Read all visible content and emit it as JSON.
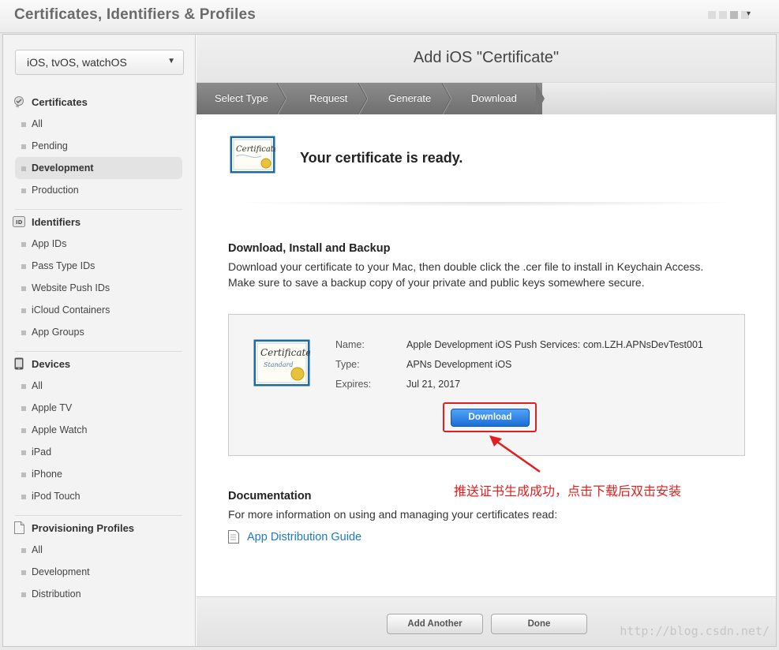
{
  "app": {
    "title": "Certificates, Identifiers & Profiles"
  },
  "sidebar": {
    "platform": "iOS, tvOS, watchOS",
    "sections": [
      {
        "title": "Certificates",
        "icon": "certificate-icon",
        "items": [
          "All",
          "Pending",
          "Development",
          "Production"
        ],
        "active": "Development"
      },
      {
        "title": "Identifiers",
        "icon": "id-badge-icon",
        "items": [
          "App IDs",
          "Pass Type IDs",
          "Website Push IDs",
          "iCloud Containers",
          "App Groups"
        ]
      },
      {
        "title": "Devices",
        "icon": "phone-icon",
        "items": [
          "All",
          "Apple TV",
          "Apple Watch",
          "iPad",
          "iPhone",
          "iPod Touch"
        ]
      },
      {
        "title": "Provisioning Profiles",
        "icon": "document-icon",
        "items": [
          "All",
          "Development",
          "Distribution"
        ]
      }
    ]
  },
  "main": {
    "page_title": "Add iOS \"Certificate\"",
    "steps": [
      "Select Type",
      "Request",
      "Generate",
      "Download"
    ],
    "ready_text": "Your certificate is ready.",
    "download_section": {
      "heading": "Download, Install and Backup",
      "text": "Download your certificate to your Mac, then double click the .cer file to install in Keychain Access. Make sure to save a backup copy of your private and public keys somewhere secure."
    },
    "certificate": {
      "name_label": "Name:",
      "name_value": "Apple Development iOS Push Services: com.LZH.APNsDevTest001",
      "type_label": "Type:",
      "type_value": "APNs Development iOS",
      "expires_label": "Expires:",
      "expires_value": "Jul 21, 2017",
      "download_label": "Download",
      "badge_title": "Certificate",
      "badge_sub": "Standard"
    },
    "annotation": "推送证书生成成功，点击下载后双击安装",
    "documentation": {
      "heading": "Documentation",
      "text": "For more information on using and managing your certificates read:",
      "link": "App Distribution Guide"
    },
    "footer": {
      "add_another": "Add Another",
      "done": "Done"
    }
  },
  "watermark": "http://blog.csdn.net/",
  "colors": {
    "link": "#1a79c8",
    "annotation": "#e02020",
    "download_button": "#1a6fd7"
  }
}
